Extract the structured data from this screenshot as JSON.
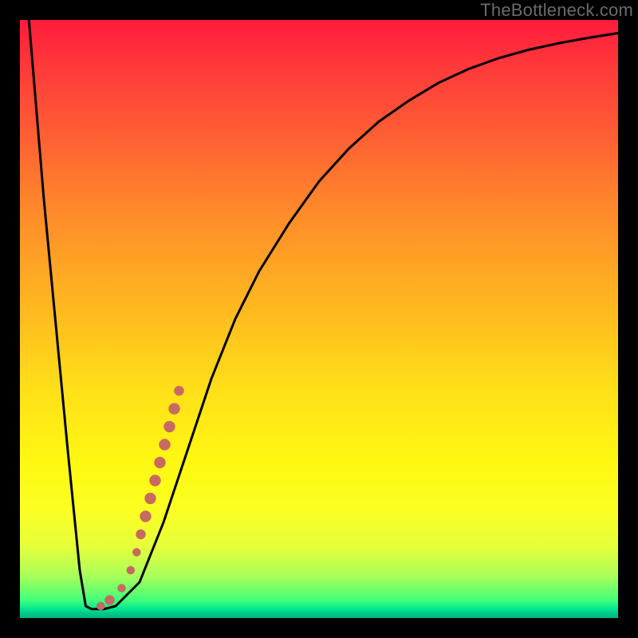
{
  "watermark": "TheBottleneck.com",
  "colors": {
    "frame_bg": "#000000",
    "curve": "#000000",
    "marker_fill": "#c96a62",
    "gradient_top": "#ff1a3c",
    "gradient_bottom": "#00b880"
  },
  "chart_data": {
    "type": "line",
    "title": "",
    "xlabel": "",
    "ylabel": "",
    "xlim": [
      0,
      100
    ],
    "ylim": [
      0,
      100
    ],
    "grid": false,
    "series": [
      {
        "name": "bottleneck-curve",
        "x": [
          0,
          4,
          8,
          10,
          11,
          12,
          14,
          16,
          20,
          24,
          28,
          32,
          36,
          40,
          45,
          50,
          55,
          60,
          65,
          70,
          75,
          80,
          85,
          90,
          95,
          100
        ],
        "values": [
          118,
          70,
          28,
          8,
          2,
          1.5,
          1.5,
          2,
          6,
          16,
          28,
          40,
          50,
          58,
          66,
          73,
          78.5,
          83,
          86.5,
          89.5,
          91.8,
          93.6,
          95,
          96.1,
          97,
          97.8
        ]
      }
    ],
    "markers": [
      {
        "x": 13.5,
        "y": 2.0,
        "r": 5
      },
      {
        "x": 15.0,
        "y": 3.0,
        "r": 6
      },
      {
        "x": 17.0,
        "y": 5.0,
        "r": 5
      },
      {
        "x": 18.5,
        "y": 8.0,
        "r": 5
      },
      {
        "x": 19.5,
        "y": 11.0,
        "r": 5
      },
      {
        "x": 20.2,
        "y": 14.0,
        "r": 6
      },
      {
        "x": 21.0,
        "y": 17.0,
        "r": 7
      },
      {
        "x": 21.8,
        "y": 20.0,
        "r": 7
      },
      {
        "x": 22.6,
        "y": 23.0,
        "r": 7
      },
      {
        "x": 23.4,
        "y": 26.0,
        "r": 7
      },
      {
        "x": 24.2,
        "y": 29.0,
        "r": 7
      },
      {
        "x": 25.0,
        "y": 32.0,
        "r": 7
      },
      {
        "x": 25.8,
        "y": 35.0,
        "r": 7
      },
      {
        "x": 26.6,
        "y": 38.0,
        "r": 6
      }
    ]
  }
}
